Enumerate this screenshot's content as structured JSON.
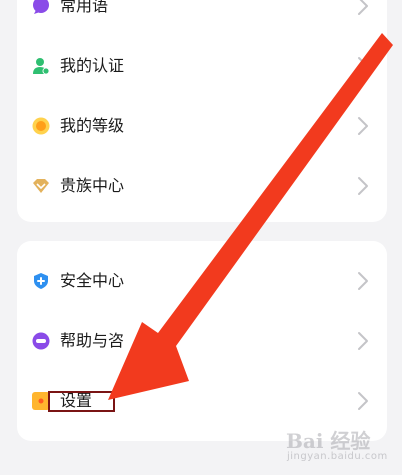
{
  "menu": {
    "group1": [
      {
        "label": "常用语",
        "icon": "chat-bubble-icon"
      },
      {
        "label": "我的认证",
        "icon": "verified-user-icon"
      },
      {
        "label": "我的等级",
        "icon": "sun-level-icon"
      },
      {
        "label": "贵族中心",
        "icon": "diamond-icon"
      }
    ],
    "group2": [
      {
        "label": "安全中心",
        "icon": "shield-plus-icon"
      },
      {
        "label": "帮助与咨",
        "icon": "help-pill-icon"
      },
      {
        "label": "设置",
        "icon": "settings-square-icon"
      }
    ]
  },
  "watermark": {
    "brand": "Bai 经验",
    "sub": "jingyan.baidu.com"
  },
  "colors": {
    "arrow": "#f23a1e",
    "highlight_border": "#7a1414",
    "chevron": "#c4c4c8",
    "verified": "#2fbf71",
    "shield": "#2e90f0",
    "help": "#8a4be8",
    "settings": "#ffb52e"
  }
}
